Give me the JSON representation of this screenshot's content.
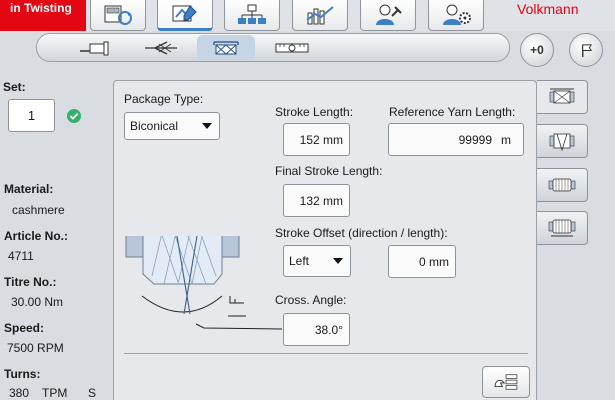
{
  "header": {
    "brand_tab": "in Twisting",
    "logo": "Volkmann",
    "main_tabs": [
      {
        "icon": "machine-refresh-icon",
        "active": false
      },
      {
        "icon": "package-edit-icon",
        "active": true
      },
      {
        "icon": "hierarchy-icon",
        "active": false
      },
      {
        "icon": "chart-icon",
        "active": false
      },
      {
        "icon": "service-person-icon",
        "active": false
      },
      {
        "icon": "operator-settings-icon",
        "active": false
      }
    ]
  },
  "subtoolbar": {
    "tabs": [
      {
        "icon": "feed-icon",
        "active": false
      },
      {
        "icon": "yarn-path-icon",
        "active": false
      },
      {
        "icon": "traverse-icon",
        "active": true
      },
      {
        "icon": "measurement-icon",
        "active": false
      }
    ],
    "round_buttons": [
      {
        "icon": "zero-reset-icon",
        "label": "+0"
      },
      {
        "icon": "flag-icon",
        "label": ""
      }
    ]
  },
  "left_panel": {
    "set_label": "Set:",
    "set_value": "1",
    "material_label": "Material:",
    "material_value": "cashmere",
    "article_label": "Article No.:",
    "article_value": "4711",
    "titre_label": "Titre No.:",
    "titre_value": "30.00 Nm",
    "speed_label": "Speed:",
    "speed_value": "7500 RPM",
    "turns_label": "Turns:",
    "turns_value": "380",
    "turns_unit": "TPM",
    "turns_direction": "S"
  },
  "main_panel": {
    "package_type_label": "Package Type:",
    "package_type_value": "Biconical",
    "stroke_length_label": "Stroke Length:",
    "stroke_length_value": "152 mm",
    "reference_yarn_length_label": "Reference Yarn Length:",
    "reference_yarn_length_value": "99999",
    "reference_yarn_length_unit": "m",
    "final_stroke_length_label": "Final Stroke Length:",
    "final_stroke_length_value": "132 mm",
    "stroke_offset_label": "Stroke Offset (direction / length):",
    "stroke_offset_direction": "Left",
    "stroke_offset_length": "0 mm",
    "cross_angle_label": "Cross. Angle:",
    "cross_angle_value": "38.0°"
  },
  "side_tabs": [
    {
      "icon": "package-traverse-icon",
      "active": true
    },
    {
      "icon": "package-angle-icon",
      "active": false
    },
    {
      "icon": "package-wind-icon",
      "active": false
    },
    {
      "icon": "package-density-icon",
      "active": false
    }
  ],
  "colors": {
    "brand_red": "#e30613",
    "accent_blue": "#3c7fc4",
    "ok_green": "#37b26c"
  }
}
